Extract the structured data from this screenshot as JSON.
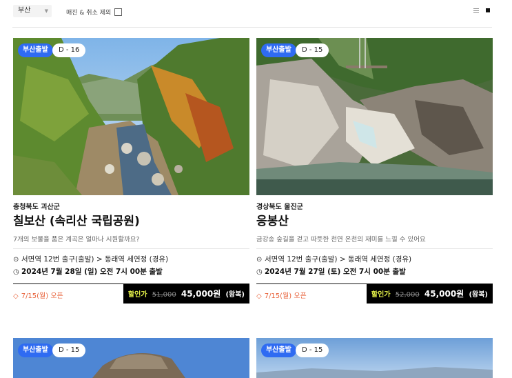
{
  "filters": {
    "region_select": "부산",
    "exclude_label": "매진 & 취소 제외"
  },
  "cards": [
    {
      "departure_badge": "부산출발",
      "d_day": "D - 16",
      "region": "충청북도 괴산군",
      "title": "칠보산 (속리산 국립공원)",
      "description": "7개의 보물을 품은 계곡은 얼마나 시원할까요?",
      "route": "서면역 12번 출구(출발) > 동래역 세연정 (경유)",
      "date": "2024년 7월 28일 (일)  오전 7시 00분 출발",
      "open": "7/15(월) 오픈",
      "discount_label": "할인가",
      "original_price": "51,000",
      "price": "45,000원",
      "trip_type": "(왕복)"
    },
    {
      "departure_badge": "부산출발",
      "d_day": "D - 15",
      "region": "경상북도 울진군",
      "title": "응봉산",
      "description": "금강송 숲길을 걷고 따뜻한 천연 온천의 재미를 느낄 수 있어요",
      "route": "서면역 12번 출구(출발) > 동래역 세연정 (경유)",
      "date": "2024년 7월 27일 (토)  오전 7시 00분 출발",
      "open": "7/15(월) 오픈",
      "discount_label": "할인가",
      "original_price": "52,000",
      "price": "45,000원",
      "trip_type": "(왕복)"
    },
    {
      "departure_badge": "부산출발",
      "d_day": "D - 15"
    },
    {
      "departure_badge": "부산출발",
      "d_day": "D - 15"
    }
  ]
}
